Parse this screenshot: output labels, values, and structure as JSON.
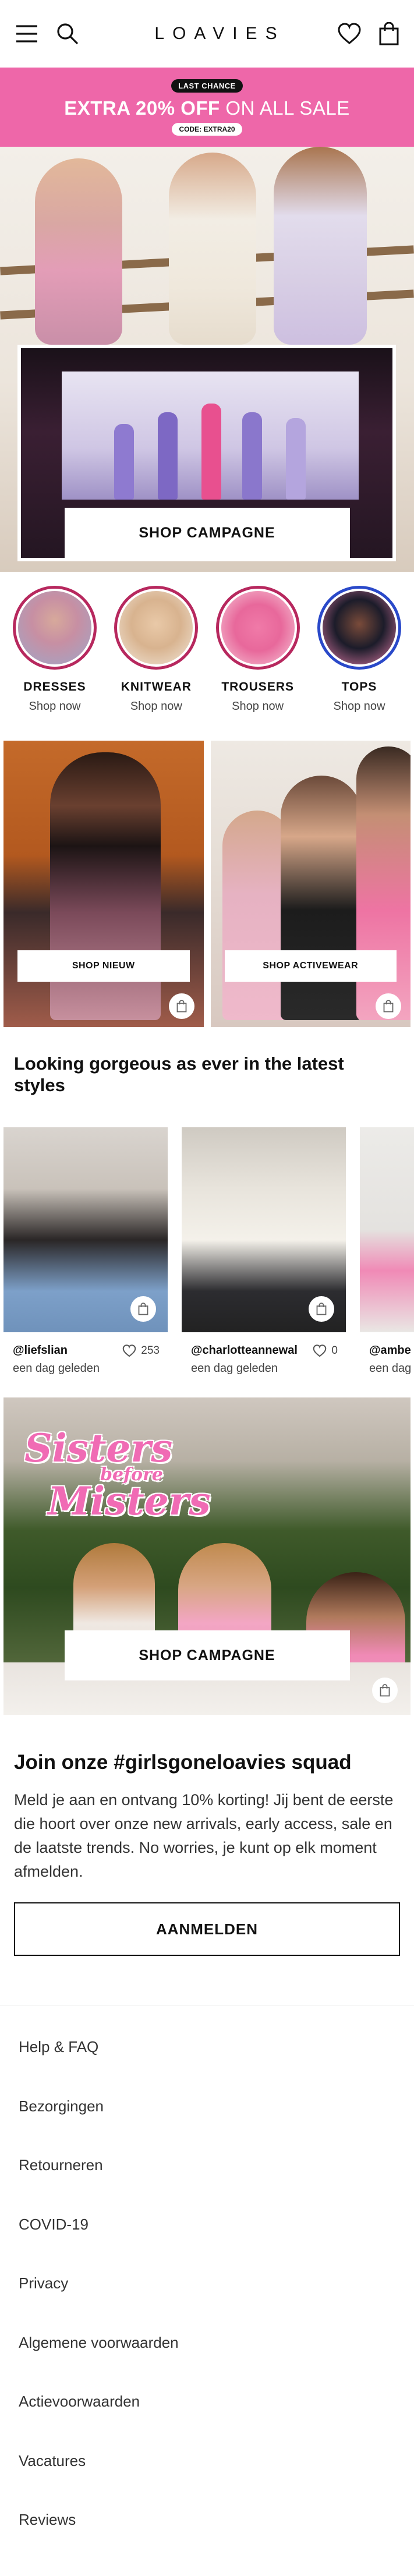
{
  "header": {
    "logo": "LOAVIES",
    "icons": [
      "menu-icon",
      "search-icon",
      "heart-icon",
      "shopping-bag-icon"
    ]
  },
  "promo": {
    "pill": "LAST CHANCE",
    "main_bold": "EXTRA 20% OFF",
    "main_rest": " ON ALL SALE",
    "code": "CODE: EXTRA20",
    "color": "#ee67a9"
  },
  "hero": {
    "cta": "SHOP CAMPAGNE"
  },
  "categories": [
    {
      "label": "DRESSES",
      "sub": "Shop now"
    },
    {
      "label": "KNITWEAR",
      "sub": "Shop now"
    },
    {
      "label": "TROUSERS",
      "sub": "Shop now"
    },
    {
      "label": "TOPS",
      "sub": "Shop now"
    }
  ],
  "tiles": [
    {
      "label": "SHOP NIEUW"
    },
    {
      "label": "SHOP ACTIVEWEAR"
    }
  ],
  "insta": {
    "title": "Looking gorgeous as ever in the latest styles",
    "posts": [
      {
        "user": "@liefslian",
        "likes": "253",
        "date": "een dag geleden"
      },
      {
        "user": "@charlotteannewal",
        "likes": "0",
        "date": "een dag geleden"
      },
      {
        "user": "@ambe",
        "likes": "",
        "date": "een dag geled"
      }
    ]
  },
  "banner2": {
    "headline_1": "Sisters",
    "headline_2": "before",
    "headline_3": "Misters",
    "cta": "SHOP CAMPAGNE"
  },
  "newsletter": {
    "title": "Join onze #girlsgoneloavies squad",
    "text": "Meld je aan en ontvang 10% korting! Jij bent de eerste die hoort over onze new arrivals, early access, sale en de laatste trends. No worries, je kunt op elk moment afmelden.",
    "button": "AANMELDEN"
  },
  "footer": {
    "links": [
      "Help & FAQ",
      "Bezorgingen",
      "Retourneren",
      "COVID-19",
      "Privacy",
      "Algemene voorwaarden",
      "Actievoorwaarden",
      "Vacatures",
      "Reviews"
    ]
  }
}
